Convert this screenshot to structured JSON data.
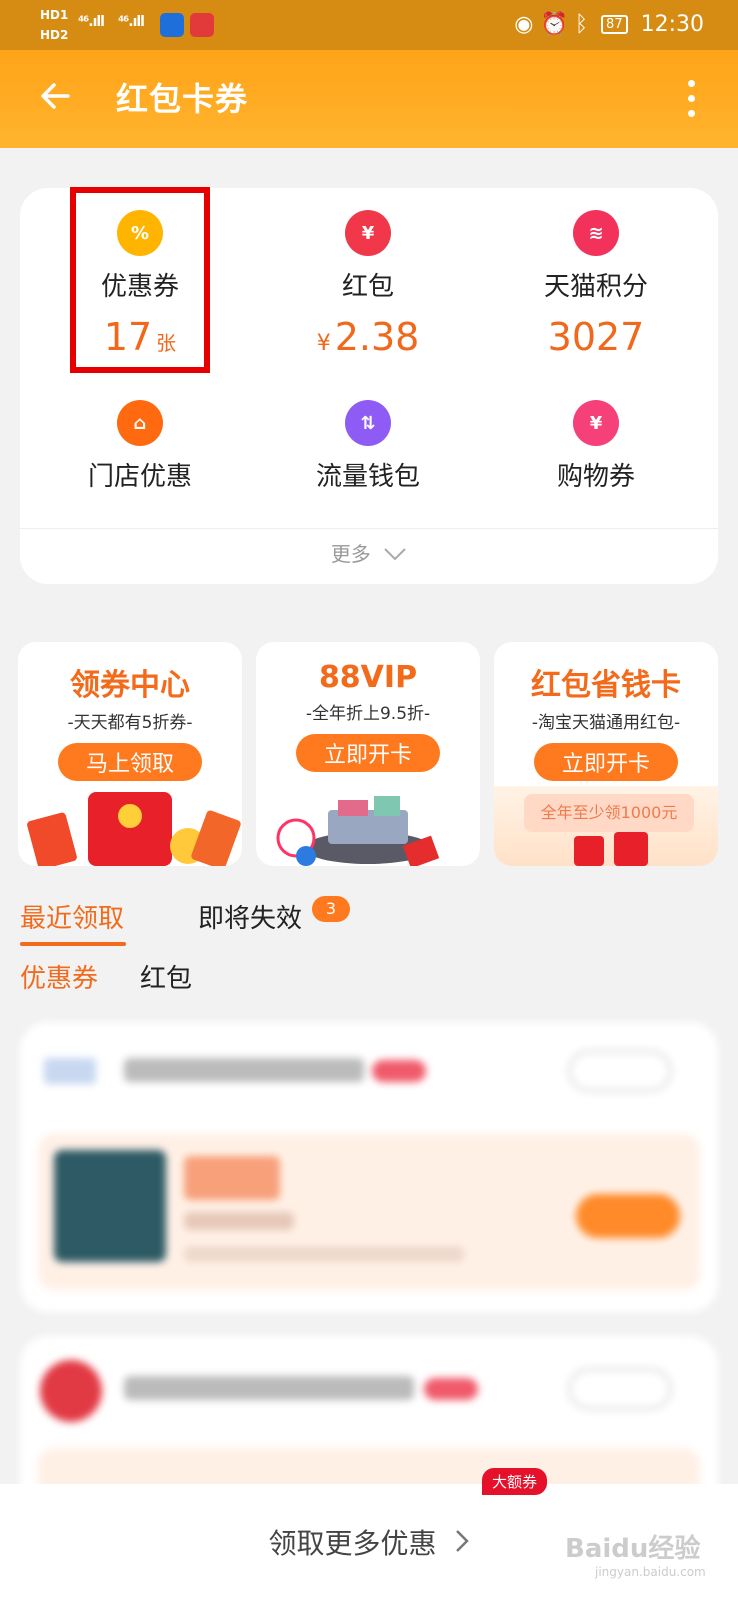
{
  "status_bar": {
    "hd1": "HD1",
    "hd2": "HD2",
    "signal1": "⁴⁶.ıll",
    "signal2": "⁴⁶.ıll",
    "battery": "87",
    "time": "12:30"
  },
  "header": {
    "title": "红包卡券"
  },
  "summary": {
    "coupon": {
      "label": "优惠券",
      "value": "17",
      "unit": "张"
    },
    "red_packet": {
      "label": "红包",
      "currency": "¥",
      "value": "2.38"
    },
    "tmall_points": {
      "label": "天猫积分",
      "value": "3027"
    },
    "store_offers": {
      "label": "门店优惠"
    },
    "data_wallet": {
      "label": "流量钱包"
    },
    "shopping_voucher": {
      "label": "购物券"
    },
    "more_label": "更多"
  },
  "promos": [
    {
      "title": "领券中心",
      "subtitle": "-天天都有5折券-",
      "button": "马上领取"
    },
    {
      "title": "88VIP",
      "subtitle": "-全年折上9.5折-",
      "button": "立即开卡"
    },
    {
      "title": "红包省钱卡",
      "subtitle": "-淘宝天猫通用红包-",
      "button": "立即开卡",
      "art_text": "全年至少领1000元"
    }
  ],
  "tabs": {
    "recent": "最近领取",
    "expiring": "即将失效",
    "expiring_count": "3"
  },
  "subtabs": {
    "coupons": "优惠券",
    "red_packets": "红包"
  },
  "bottom": {
    "cta": "领取更多优惠",
    "badge": "大额券"
  },
  "watermark": {
    "text": "Baidu经验",
    "sub": "jingyan.baidu.com"
  },
  "colors": {
    "accent": "#f26b1d",
    "header": "#ffa318",
    "status_bar": "#d68b12",
    "highlight_box": "#e60000"
  }
}
